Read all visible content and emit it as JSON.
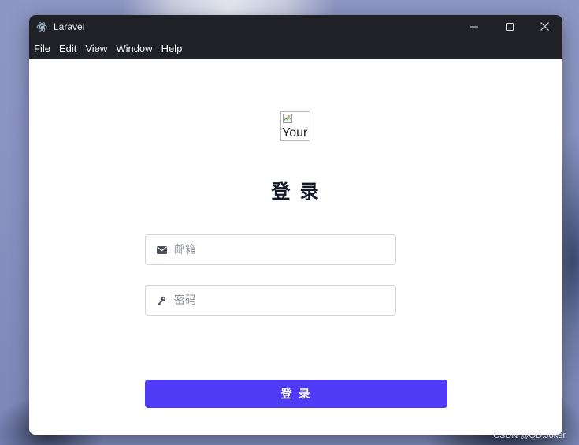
{
  "window": {
    "title": "Laravel"
  },
  "menu": {
    "items": [
      "File",
      "Edit",
      "View",
      "Window",
      "Help"
    ]
  },
  "login": {
    "logo_alt": "Your",
    "heading": "登 录",
    "email_placeholder": "邮箱",
    "password_placeholder": "密码",
    "submit_label": "登 录"
  },
  "watermark": "CSDN @QD.Joker",
  "colors": {
    "titlebar": "#1f2126",
    "accent": "#4f3bf5",
    "heading": "#111827"
  }
}
